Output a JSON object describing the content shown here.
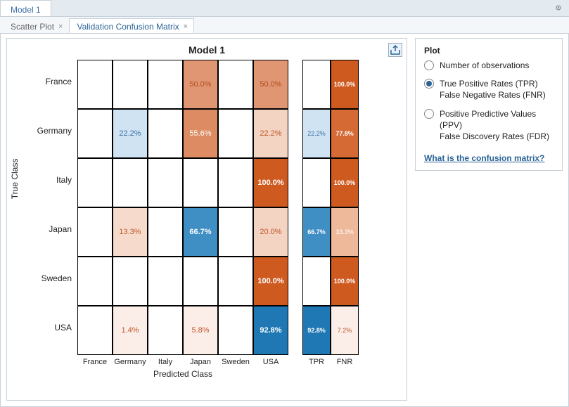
{
  "outerTab": "Model 1",
  "innerTabs": {
    "scatter": "Scatter Plot",
    "confusion": "Validation Confusion Matrix"
  },
  "chartTitle": "Model 1",
  "yAxisLabel": "True Class",
  "xAxisLabel": "Predicted Class",
  "rowLabels": {
    "r0": "France",
    "r1": "Germany",
    "r2": "Italy",
    "r3": "Japan",
    "r4": "Sweden",
    "r5": "USA"
  },
  "colLabels": {
    "c0": "France",
    "c1": "Germany",
    "c2": "Italy",
    "c3": "Japan",
    "c4": "Sweden",
    "c5": "USA",
    "tpr": "TPR",
    "fnr": "FNR"
  },
  "cells": {
    "r0c3": "50.0%",
    "r0c5": "50.0%",
    "r1c1": "22.2%",
    "r1c3": "55.6%",
    "r1c5": "22.2%",
    "r2c5": "100.0%",
    "r3c1": "13.3%",
    "r3c3": "66.7%",
    "r3c5": "20.0%",
    "r4c5": "100.0%",
    "r5c1": "1.4%",
    "r5c3": "5.8%",
    "r5c5": "92.8%",
    "r0fnr": "100.0%",
    "r1tpr": "22.2%",
    "r1fnr": "77.8%",
    "r2fnr": "100.0%",
    "r3tpr": "66.7%",
    "r3fnr": "33.3%",
    "r4fnr": "100.0%",
    "r5tpr": "92.8%",
    "r5fnr": "7.2%"
  },
  "panel": {
    "title": "Plot",
    "opt1": "Number of observations",
    "opt2a": "True Positive Rates (TPR)",
    "opt2b": "False Negative Rates (FNR)",
    "opt3a": "Positive Predictive Values (PPV)",
    "opt3b": "False Discovery Rates (FDR)",
    "helpLink": "What is the confusion matrix?"
  },
  "chart_data": {
    "type": "heatmap",
    "title": "Model 1",
    "xlabel": "Predicted Class",
    "ylabel": "True Class",
    "row_categories": [
      "France",
      "Germany",
      "Italy",
      "Japan",
      "Sweden",
      "USA"
    ],
    "col_categories": [
      "France",
      "Germany",
      "Italy",
      "Japan",
      "Sweden",
      "USA"
    ],
    "values_percent": [
      [
        null,
        null,
        null,
        50.0,
        null,
        50.0
      ],
      [
        null,
        22.2,
        null,
        55.6,
        null,
        22.2
      ],
      [
        null,
        null,
        null,
        null,
        null,
        100.0
      ],
      [
        null,
        13.3,
        null,
        66.7,
        null,
        20.0
      ],
      [
        null,
        null,
        null,
        null,
        null,
        100.0
      ],
      [
        null,
        1.4,
        null,
        5.8,
        null,
        92.8
      ]
    ],
    "tpr_percent": [
      null,
      22.2,
      null,
      66.7,
      null,
      92.8
    ],
    "fnr_percent": [
      100.0,
      77.8,
      100.0,
      33.3,
      100.0,
      7.2
    ],
    "value_unit": "percent"
  }
}
